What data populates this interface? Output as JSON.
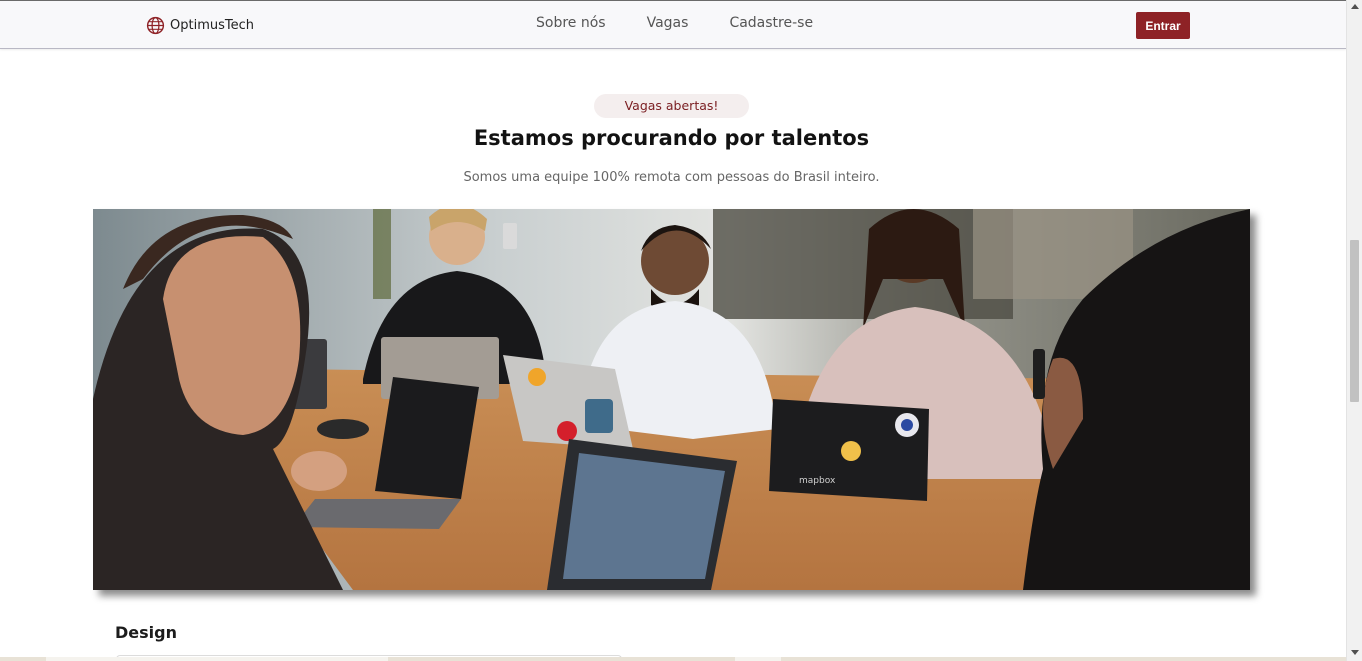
{
  "navbar": {
    "brand_name": "OptimusTech",
    "brand_icon": "globe-icon",
    "links": [
      "Sobre nós",
      "Vagas",
      "Cadastre-se"
    ],
    "login_label": "Entrar",
    "accent_color": "#8e2226"
  },
  "hero": {
    "badge": "Vagas abertas!",
    "title": "Estamos procurando por talentos",
    "subtitle": "Somos uma equipe 100% remota com pessoas do Brasil inteiro."
  },
  "photo": {
    "laptop_sticker_text": "mapbox"
  },
  "section": {
    "title": "Design"
  }
}
